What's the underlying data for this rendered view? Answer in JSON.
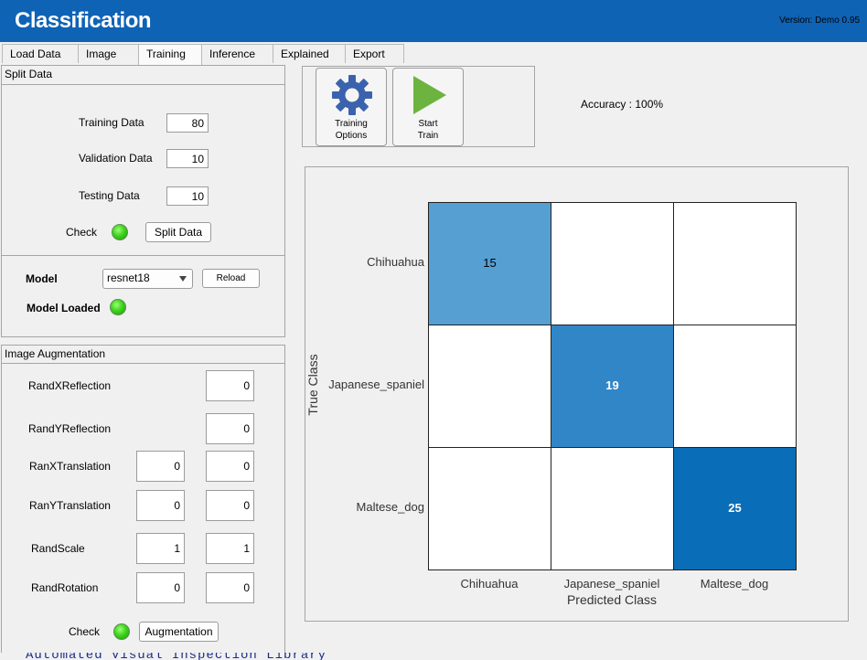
{
  "app": {
    "title": "Classification",
    "version": "Version: Demo 0.95"
  },
  "tabs": [
    {
      "label": "Load Data"
    },
    {
      "label": "Image"
    },
    {
      "label": "Training",
      "active": true
    },
    {
      "label": "Inference"
    },
    {
      "label": "Explained"
    },
    {
      "label": "Export"
    }
  ],
  "split_data": {
    "title": "Split Data",
    "training_label": "Training Data",
    "training_value": "80",
    "validation_label": "Validation Data",
    "validation_value": "10",
    "testing_label": "Testing Data",
    "testing_value": "10",
    "check_label": "Check",
    "split_button": "Split Data",
    "check_status_color": "#3fd41c"
  },
  "model": {
    "label": "Model",
    "selected": "resnet18",
    "reload_button": "Reload",
    "loaded_label": "Model Loaded",
    "loaded_status_color": "#3fd41c"
  },
  "augmentation": {
    "title": "Image Augmentation",
    "rows": [
      {
        "label": "RandXReflection",
        "values": [
          "0"
        ]
      },
      {
        "label": "RandYReflection",
        "values": [
          "0"
        ]
      },
      {
        "label": "RanXTranslation",
        "values": [
          "0",
          "0"
        ]
      },
      {
        "label": "RanYTranslation",
        "values": [
          "0",
          "0"
        ]
      },
      {
        "label": "RandScale",
        "values": [
          "1",
          "1"
        ]
      },
      {
        "label": "RandRotation",
        "values": [
          "0",
          "0"
        ]
      }
    ],
    "check_label": "Check",
    "aug_button": "Augmentation"
  },
  "toolbar": {
    "training_options_line1": "Training",
    "training_options_line2": "Options",
    "start_train_line1": "Start",
    "start_train_line2": "Train",
    "gear_icon": "gear-icon",
    "play_icon": "play-icon"
  },
  "accuracy": "Accuracy : 100%",
  "chart_data": {
    "type": "heatmap",
    "xlabel": "Predicted Class",
    "ylabel": "True Class",
    "x_categories": [
      "Chihuahua",
      "Japanese_spaniel",
      "Maltese_dog"
    ],
    "y_categories": [
      "Chihuahua",
      "Japanese_spaniel",
      "Maltese_dog"
    ],
    "values": [
      [
        15,
        null,
        null
      ],
      [
        null,
        19,
        null
      ],
      [
        null,
        null,
        25
      ]
    ],
    "cell_colors": [
      [
        "#569fd3",
        "#ffffff",
        "#ffffff"
      ],
      [
        "#ffffff",
        "#3186c8",
        "#ffffff"
      ],
      [
        "#ffffff",
        "#ffffff",
        "#0a6db7"
      ]
    ]
  },
  "bottom_text": "Automated Visual Inspection Library"
}
